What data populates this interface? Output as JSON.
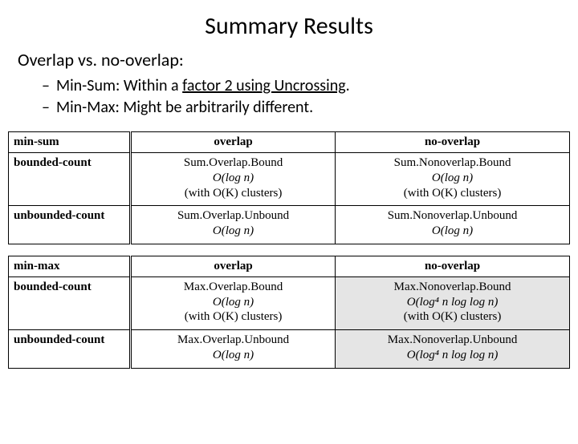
{
  "title": "Summary Results",
  "subhead": "Overlap vs. no-overlap:",
  "bullets": {
    "minsum_prefix": "Min-Sum: Within a ",
    "minsum_link": "factor 2 using Uncrossing",
    "minsum_suffix": ".",
    "minmax": "Min-Max: Might be arbitrarily different."
  },
  "table1": {
    "h0": "min-sum",
    "h1": "overlap",
    "h2": "no-overlap",
    "r1": "bounded-count",
    "r2": "unbounded-count",
    "c11a": "Sum.Overlap.Bound",
    "c11b": "O(log n)",
    "c11c": "(with O(K) clusters)",
    "c12a": "Sum.Nonoverlap.Bound",
    "c12b": "O(log n)",
    "c12c": "(with O(K) clusters)",
    "c21a": "Sum.Overlap.Unbound",
    "c21b": "O(log n)",
    "c22a": "Sum.Nonoverlap.Unbound",
    "c22b": "O(log n)"
  },
  "table2": {
    "h0": "min-max",
    "h1": "overlap",
    "h2": "no-overlap",
    "r1": "bounded-count",
    "r2": "unbounded-count",
    "c11a": "Max.Overlap.Bound",
    "c11b": "O(log n)",
    "c11c": "(with O(K) clusters)",
    "c12a": "Max.Nonoverlap.Bound",
    "c12b": "O(log⁴ n log log n)",
    "c12c": "(with O(K) clusters)",
    "c21a": "Max.Overlap.Unbound",
    "c21b": "O(log n)",
    "c22a": "Max.Nonoverlap.Unbound",
    "c22b": "O(log⁴ n log log n)"
  }
}
